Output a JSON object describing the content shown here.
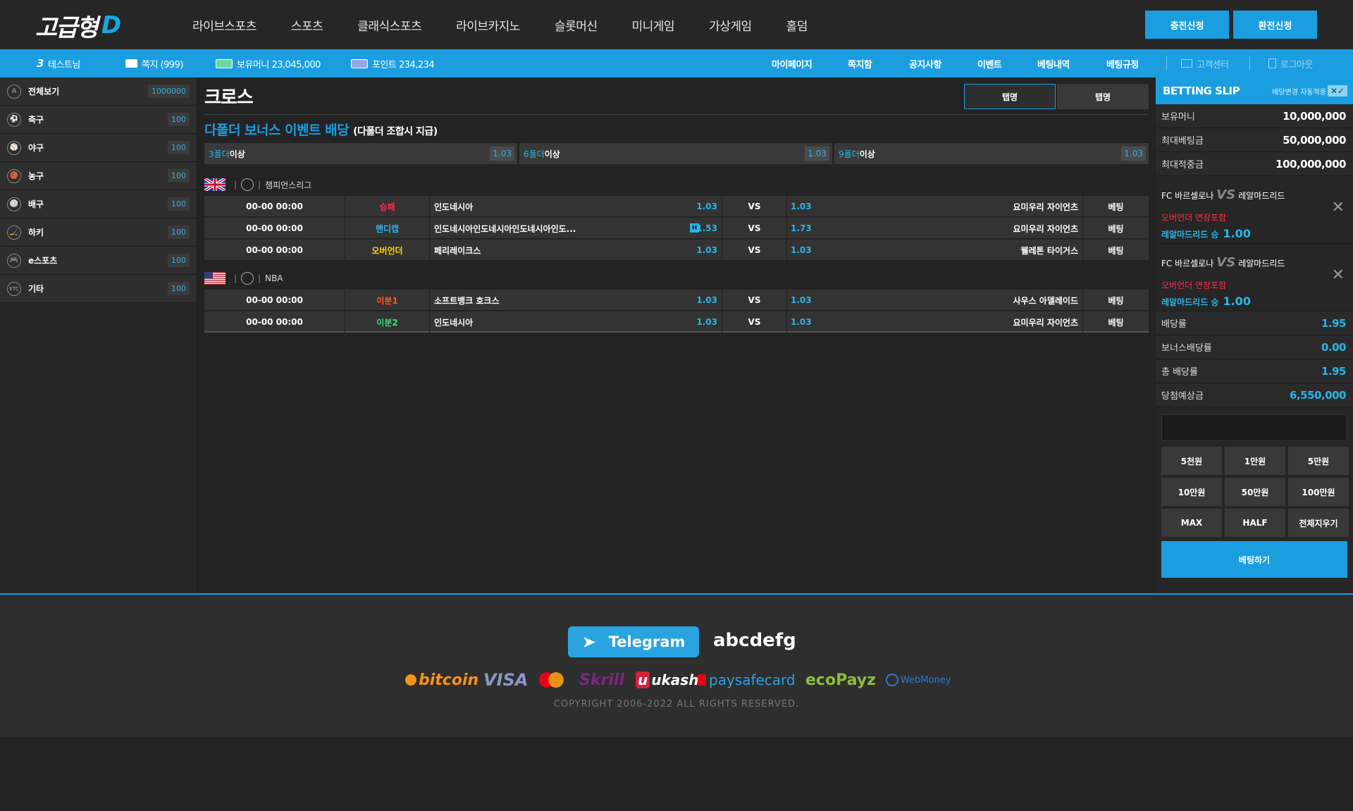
{
  "brand": {
    "logo_text": "고급형",
    "logo_suffix": "D"
  },
  "nav": [
    "라이브스포츠",
    "스포츠",
    "클래식스포츠",
    "라이브카지노",
    "슬롯머신",
    "미니게임",
    "가상게임",
    "홀덤"
  ],
  "header_buttons": {
    "charge": "충전신청",
    "exchange": "환전신청"
  },
  "subbar": {
    "level": "3",
    "user": "테스트님",
    "messages": "쪽지 (999)",
    "money": "보유머니 23,045,000",
    "points": "포인트 234,234",
    "links": [
      "마이페이지",
      "쪽지함",
      "공지사항",
      "이벤트",
      "베팅내역",
      "베팅규정"
    ],
    "support": "고객센터",
    "logout": "로그아웃"
  },
  "sidebar": {
    "items": [
      {
        "icon": "A",
        "label": "전체보기",
        "count": "1000000"
      },
      {
        "icon": "⚽",
        "label": "축구",
        "count": "100"
      },
      {
        "icon": "⚾",
        "label": "야구",
        "count": "100"
      },
      {
        "icon": "🏀",
        "label": "농구",
        "count": "100"
      },
      {
        "icon": "🏐",
        "label": "배구",
        "count": "100"
      },
      {
        "icon": "🏒",
        "label": "하키",
        "count": "100"
      },
      {
        "icon": "🎮",
        "label": "e스포츠",
        "count": "100"
      },
      {
        "icon": "ETC",
        "label": "기타",
        "count": "100"
      }
    ]
  },
  "main": {
    "title": "크로스",
    "tabs": [
      "탭명",
      "탭명"
    ],
    "bonus_title": "다폴더 보너스 이벤트 배당",
    "bonus_sub": "(다폴더 조합시 지급)",
    "folds": [
      {
        "n": "3폴더",
        "t": "이상",
        "odds": "1.03"
      },
      {
        "n": "6폴더",
        "t": "이상",
        "odds": "1.03"
      },
      {
        "n": "9폴더",
        "t": "이상",
        "odds": "1.03"
      }
    ],
    "leagues": [
      {
        "name": "챔피언스리그",
        "matches": [
          {
            "time": "00-00 00:00",
            "type": "승패",
            "type_color": "#ff2f4d",
            "home": "인도네시아",
            "h_odds": "1.03",
            "vs": "VS",
            "a_odds": "1.03",
            "away": "요미우리 자이언츠",
            "bet": "베팅",
            "badge": ""
          },
          {
            "time": "00-00 00:00",
            "type": "핸디캡",
            "type_color": "#29b6e8",
            "home": "인도네시아인도네시아인도네시아인도...",
            "h_odds": "1.53",
            "vs": "VS",
            "a_odds": "1.73",
            "away": "요미우리 자이언츠",
            "bet": "베팅",
            "badge": "H"
          },
          {
            "time": "00-00 00:00",
            "type": "오버언더",
            "type_color": "#ffd400",
            "home": "페리레이크스",
            "h_odds": "1.03",
            "vs": "VS",
            "a_odds": "1.03",
            "away": "웰레톤 타이거스",
            "bet": "베팅",
            "badge": ""
          }
        ]
      },
      {
        "name": "NBA",
        "matches": [
          {
            "time": "00-00 00:00",
            "type": "이분1",
            "type_color": "#ff5a2f",
            "home": "소프트뱅크 호크스",
            "h_odds": "1.03",
            "vs": "VS",
            "a_odds": "1.03",
            "away": "사우스 아델레이드",
            "bet": "베팅",
            "badge": ""
          },
          {
            "time": "00-00 00:00",
            "type": "이분2",
            "type_color": "#3ee07a",
            "home": "인도네시아",
            "h_odds": "1.03",
            "vs": "VS",
            "a_odds": "1.03",
            "away": "요미우리 자이언츠",
            "bet": "베팅",
            "badge": ""
          }
        ]
      }
    ]
  },
  "slip": {
    "title": "BETTING SLIP",
    "auto_label": "배당변경 자동적용",
    "top_rows": [
      {
        "label": "보유머니",
        "value": "10,000,000"
      },
      {
        "label": "최대베팅금",
        "value": "50,000,000"
      },
      {
        "label": "최대적중금",
        "value": "100,000,000"
      }
    ],
    "cards": [
      {
        "home": "FC 바르셀로나",
        "vs": "VS",
        "away": "레알마드리드",
        "market": "오버언더 연장포함",
        "pick": "레알마드리드 승",
        "odds": "1.00"
      },
      {
        "home": "FC 바르셀로나",
        "vs": "VS",
        "away": "레알마드리드",
        "market": "오버언더 연장포함",
        "pick": "레알마드리드 승",
        "odds": "1.00"
      }
    ],
    "bottom_rows": [
      {
        "label": "배당률",
        "value": "1.95"
      },
      {
        "label": "보너스배당률",
        "value": "0.00"
      },
      {
        "label": "총 배당률",
        "value": "1.95"
      },
      {
        "label": "당첨예상금",
        "value": "6,550,000"
      }
    ],
    "amount_buttons": [
      "5천원",
      "1만원",
      "5만원",
      "10만원",
      "50만원",
      "100만원",
      "MAX",
      "HALF",
      "전체지우기"
    ],
    "bet_button": "베팅하기"
  },
  "footer": {
    "telegram": "Telegram",
    "telegram_id": "abcdefg",
    "payments": [
      "bitcoin",
      "VISA",
      "Skrill",
      "ukash",
      "paysafecard",
      "ecoPayz",
      "WebMoney"
    ],
    "copyright": "COPYRIGHT  2006-2022  ALL RIGHTS RESERVED."
  }
}
